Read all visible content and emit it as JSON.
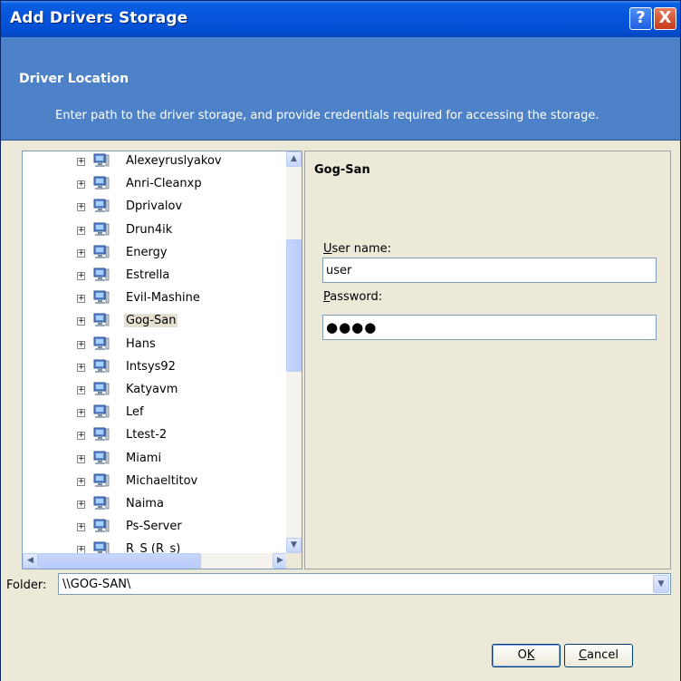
{
  "window": {
    "title": "Add Drivers Storage",
    "help_label": "?",
    "close_label": "X"
  },
  "header": {
    "title": "Driver Location",
    "description": "Enter path to the driver storage, and provide credentials required for accessing the storage."
  },
  "tree": {
    "items": [
      {
        "label": "Alexeyruslyakov"
      },
      {
        "label": "Anri-Cleanxp"
      },
      {
        "label": "Dprivalov"
      },
      {
        "label": "Drun4ik"
      },
      {
        "label": "Energy"
      },
      {
        "label": "Estrella"
      },
      {
        "label": "Evil-Mashine"
      },
      {
        "label": "Gog-San",
        "selected": true
      },
      {
        "label": "Hans"
      },
      {
        "label": "Intsys92"
      },
      {
        "label": "Katyavm"
      },
      {
        "label": "Lef"
      },
      {
        "label": "Ltest-2"
      },
      {
        "label": "Miami"
      },
      {
        "label": "Michaeltitov"
      },
      {
        "label": "Naima"
      },
      {
        "label": "Ps-Server"
      },
      {
        "label": "R_S (R_s)"
      }
    ]
  },
  "details": {
    "title": "Gog-San",
    "username_label_first": "U",
    "username_label_rest": "ser name:",
    "username_value": "user",
    "password_label_first": "P",
    "password_label_rest": "assword:",
    "password_value": "●●●●"
  },
  "folder": {
    "label": "Folder:",
    "value": "\\\\GOG-SAN\\"
  },
  "buttons": {
    "ok_first": "O",
    "ok_underlined": "K",
    "ok_rest": "",
    "cancel_first": "",
    "cancel_underlined": "C",
    "cancel_rest": "ancel"
  },
  "colors": {
    "header_bg": "#4d82c8",
    "title_bar": "#0555dc",
    "dialog_bg": "#ece9d8"
  }
}
